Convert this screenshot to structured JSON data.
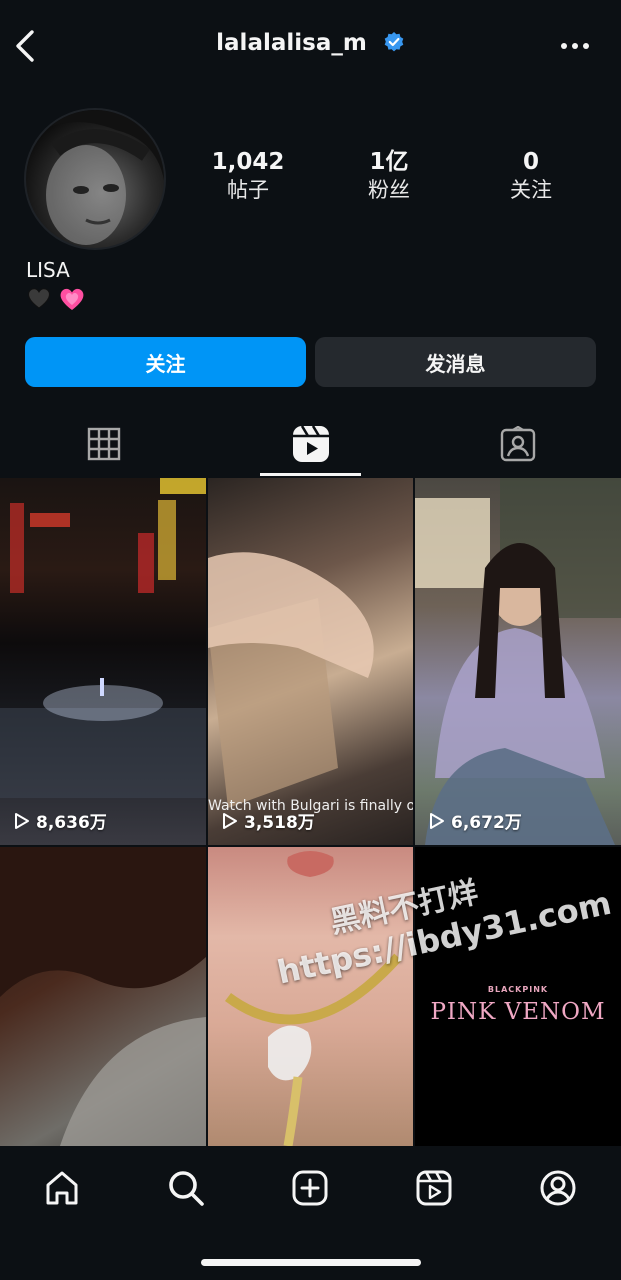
{
  "header": {
    "username": "lalalalisa_m"
  },
  "profile": {
    "stats": [
      {
        "value": "1,042",
        "label": "帖子"
      },
      {
        "value": "1亿",
        "label": "粉丝"
      },
      {
        "value": "0",
        "label": "关注"
      }
    ],
    "display_name": "LISA",
    "bio_emojis": [
      "black-heart",
      "growing-heart"
    ]
  },
  "actions": {
    "follow_label": "关注",
    "message_label": "发消息"
  },
  "tabs": [
    {
      "name": "posts-grid",
      "icon": "grid-icon",
      "active": false
    },
    {
      "name": "reels",
      "icon": "reels-icon",
      "active": true
    },
    {
      "name": "tagged",
      "icon": "tagged-icon",
      "active": false
    }
  ],
  "reels": [
    {
      "views": "8,636万"
    },
    {
      "views": "3,518万",
      "caption_overlay": "Watch with Bulgari is finally ou"
    },
    {
      "views": "6,672万"
    },
    {},
    {},
    {
      "brand": "BLACKPINK",
      "title": "PINK VENOM"
    }
  ],
  "watermark": {
    "line1": "黑料不打烊",
    "line2": "https://ibdy31.com"
  },
  "bottom_nav": [
    "home-icon",
    "search-icon",
    "create-icon",
    "reels-icon",
    "profile-icon"
  ],
  "colors": {
    "background": "#0c1014",
    "accent": "#0095f6",
    "secondary_button": "#25292e"
  }
}
